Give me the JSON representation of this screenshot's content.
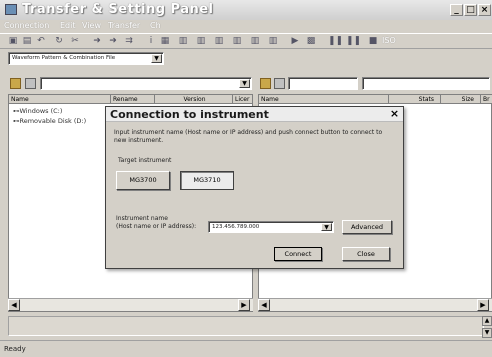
{
  "window": {
    "title": "Transfer & Setting Panel",
    "min": "_",
    "max": "□",
    "close": "×"
  },
  "menu": [
    "Connection",
    "Edit",
    "View",
    "Transfer",
    "Ch"
  ],
  "toolbar": {
    "icons": [
      "save-icon",
      "open-icon",
      "undo-icon",
      "refresh-icon",
      "cut-icon",
      "transfer-right-icon",
      "transfer-left-icon",
      "send-icon",
      "info-icon",
      "waveform-icon",
      "waveform-icon",
      "waveform-icon",
      "waveform-icon",
      "waveform-icon",
      "waveform-icon",
      "play-icon",
      "stop-icon",
      "pause-icon",
      "pause-icon",
      "dot-icon"
    ],
    "end_label": "ISO"
  },
  "file_type": {
    "selected": "Waveform Pattern & Combination File"
  },
  "left_pane": {
    "columns": [
      "Name",
      "Rename",
      "Version",
      "Licer"
    ],
    "items": [
      "Windows (C:)",
      "Removable Disk (D:)"
    ]
  },
  "right_pane": {
    "columns": [
      "Name",
      "Stats",
      "Size",
      "Br"
    ]
  },
  "status": {
    "text": "Ready"
  },
  "dialog": {
    "title": "Connection to instrument",
    "close": "×",
    "instruction": "Input instrument name (Host name or IP address) and push connect button to connect to new instrument.",
    "target_label": "Target instrument",
    "instrument_a": "MG3700",
    "instrument_b": "MG3710",
    "name_label_1": "Instrument name",
    "name_label_2": "(Host name or IP address):",
    "address_value": "123.456.789.000",
    "advanced_label": "Advanced",
    "connect_label": "Connect",
    "close_label": "Close"
  }
}
